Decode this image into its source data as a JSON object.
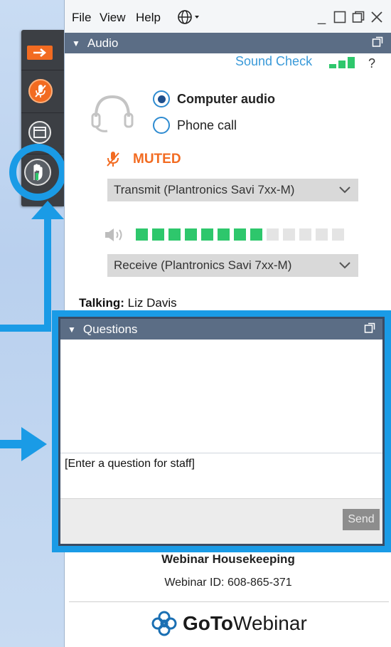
{
  "menu": {
    "file": "File",
    "view": "View",
    "help": "Help"
  },
  "audio_panel": {
    "title": "Audio",
    "sound_check": "Sound Check",
    "help_mark": "?",
    "computer_audio": "Computer audio",
    "phone_call": "Phone call",
    "selected_mode": "Computer audio",
    "muted_label": "MUTED",
    "transmit_device": "Transmit (Plantronics Savi 7xx-M)",
    "receive_device": "Receive (Plantronics Savi 7xx-M)",
    "level_segments_total": 13,
    "level_segments_active": 8
  },
  "talking": {
    "label": "Talking:",
    "name": "Liz Davis"
  },
  "questions_panel": {
    "title": "Questions",
    "input_placeholder": "[Enter a question for staff]",
    "send_label": "Send"
  },
  "footer": {
    "title": "Webinar Housekeeping",
    "webinar_id": "Webinar ID: 608-865-371",
    "brand_goto": "GoTo",
    "brand_webinar": "Webinar"
  },
  "colors": {
    "accent_orange": "#f26b21",
    "annotation_blue": "#1a9be6",
    "panel_header": "#5b6d85",
    "level_green": "#2ec76c",
    "link_blue": "#3a9ad9"
  },
  "icons": [
    "arrow-right-icon",
    "microphone-muted-icon",
    "window-icon",
    "raise-hand-icon",
    "globe-icon",
    "headset-icon",
    "speaker-icon",
    "gotowebinar-logo-icon"
  ]
}
